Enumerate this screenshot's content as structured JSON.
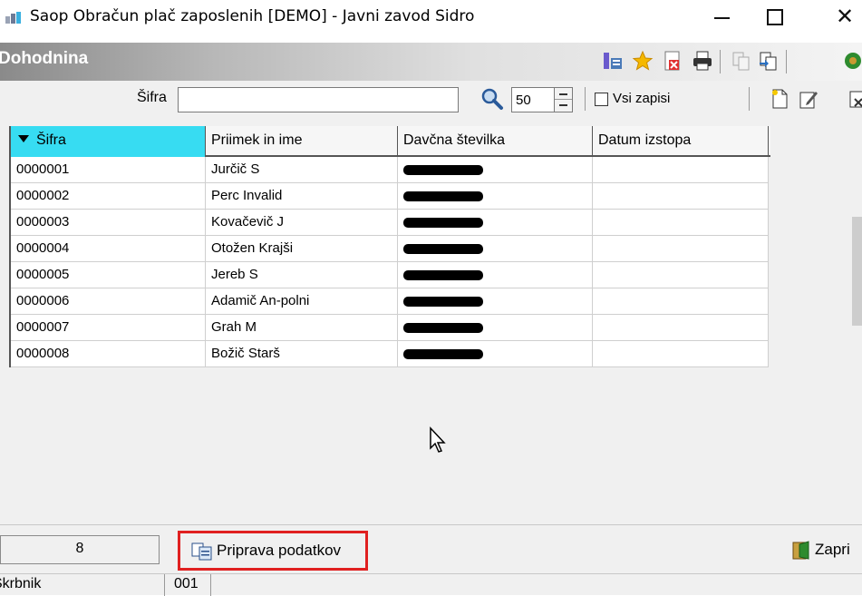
{
  "window": {
    "title": "Saop Obračun plač zaposlenih [DEMO] - Javni zavod Sidro",
    "close_glyph": "✕"
  },
  "form": {
    "title": "Dohodnina",
    "toolbar_icons": [
      "grid-settings-icon",
      "favorite-star-icon",
      "export-pdf-icon",
      "print-icon",
      "copy-disabled-icon",
      "copy-icon",
      "refresh-icon"
    ],
    "record_toolbar_icons": [
      "new-record-icon",
      "edit-record-icon",
      "delete-record-icon"
    ]
  },
  "search": {
    "label": "Šifra",
    "value": "",
    "count_value": "50",
    "show_all_label": "Vsi zapisi",
    "show_all_checked": false
  },
  "grid": {
    "sort_column": "Šifra",
    "columns": [
      "Šifra",
      "Priimek in ime",
      "Davčna številka",
      "Datum izstopa"
    ],
    "rows": [
      {
        "code": "0000001",
        "name": "Jurčič S",
        "tax": "",
        "exit": ""
      },
      {
        "code": "0000002",
        "name": "Perc Invalid",
        "tax": "",
        "exit": ""
      },
      {
        "code": "0000003",
        "name": "Kovačevič J",
        "tax": "",
        "exit": ""
      },
      {
        "code": "0000004",
        "name": "Otožen Krajši",
        "tax": "",
        "exit": ""
      },
      {
        "code": "0000005",
        "name": "Jereb S",
        "tax": "",
        "exit": ""
      },
      {
        "code": "0000006",
        "name": "Adamič An-polni",
        "tax": "",
        "exit": ""
      },
      {
        "code": "0000007",
        "name": "Grah M",
        "tax": "",
        "exit": ""
      },
      {
        "code": "0000008",
        "name": "Božič Starš",
        "tax": "",
        "exit": ""
      }
    ]
  },
  "bottom": {
    "record_count": "8",
    "prepare_label": "Priprava podatkov",
    "close_label": "Zapri"
  },
  "status": {
    "user": "Skrbnik",
    "code": "001"
  },
  "colors": {
    "sorted_header": "#37dcf2",
    "highlight_border": "#e02020"
  }
}
